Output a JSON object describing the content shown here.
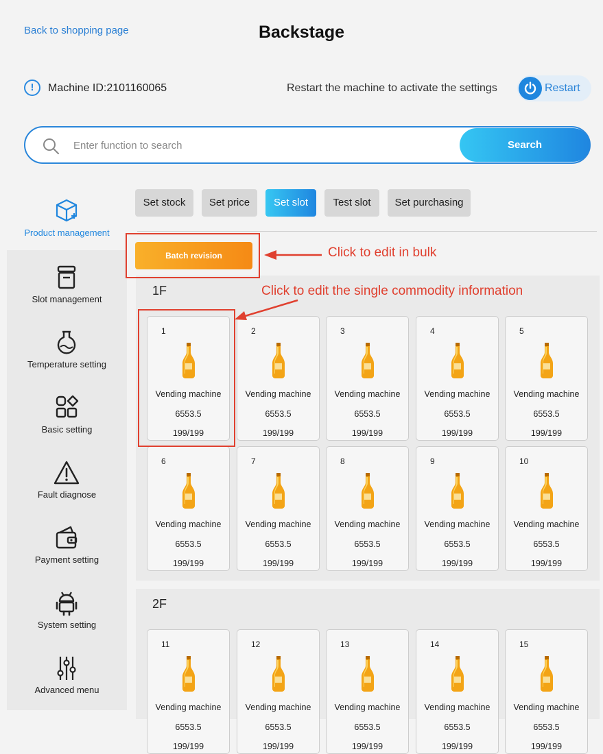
{
  "header": {
    "back_link": "Back to shopping page",
    "title": "Backstage",
    "machine_id": "Machine ID:2101160065",
    "restart_hint": "Restart the machine to activate the settings",
    "restart_label": "Restart",
    "info_glyph": "!"
  },
  "search": {
    "placeholder": "Enter function to search",
    "value": "",
    "button_label": "Search"
  },
  "sidebar": {
    "items": [
      {
        "label": "Product management",
        "icon": "box-icon",
        "active": true
      },
      {
        "label": "Slot management",
        "icon": "archive-icon",
        "active": false
      },
      {
        "label": "Temperature setting",
        "icon": "flask-icon",
        "active": false
      },
      {
        "label": "Basic setting",
        "icon": "grid-icon",
        "active": false
      },
      {
        "label": "Fault diagnose",
        "icon": "warning-icon",
        "active": false
      },
      {
        "label": "Payment setting",
        "icon": "wallet-icon",
        "active": false
      },
      {
        "label": "System setting",
        "icon": "android-icon",
        "active": false
      },
      {
        "label": "Advanced menu",
        "icon": "sliders-icon",
        "active": false
      }
    ]
  },
  "tabs": [
    {
      "label": "Set stock",
      "active": false
    },
    {
      "label": "Set price",
      "active": false
    },
    {
      "label": "Set slot",
      "active": true
    },
    {
      "label": "Test slot",
      "active": false
    },
    {
      "label": "Set purchasing",
      "active": false
    }
  ],
  "batch_button": "Batch revision",
  "annotations": {
    "bulk": "Click to edit in bulk",
    "single": "Click to edit the single commodity information"
  },
  "floors": [
    {
      "title": "1F",
      "slots": [
        {
          "num": "1",
          "name": "Vending machine",
          "price": "6553.5",
          "stock": "199/199"
        },
        {
          "num": "2",
          "name": "Vending machine",
          "price": "6553.5",
          "stock": "199/199"
        },
        {
          "num": "3",
          "name": "Vending machine",
          "price": "6553.5",
          "stock": "199/199"
        },
        {
          "num": "4",
          "name": "Vending machine",
          "price": "6553.5",
          "stock": "199/199"
        },
        {
          "num": "5",
          "name": "Vending machine",
          "price": "6553.5",
          "stock": "199/199"
        },
        {
          "num": "6",
          "name": "Vending machine",
          "price": "6553.5",
          "stock": "199/199"
        },
        {
          "num": "7",
          "name": "Vending machine",
          "price": "6553.5",
          "stock": "199/199"
        },
        {
          "num": "8",
          "name": "Vending machine",
          "price": "6553.5",
          "stock": "199/199"
        },
        {
          "num": "9",
          "name": "Vending machine",
          "price": "6553.5",
          "stock": "199/199"
        },
        {
          "num": "10",
          "name": "Vending machine",
          "price": "6553.5",
          "stock": "199/199"
        }
      ]
    },
    {
      "title": "2F",
      "slots": [
        {
          "num": "11",
          "name": "Vending machine",
          "price": "6553.5",
          "stock": "199/199"
        },
        {
          "num": "12",
          "name": "Vending machine",
          "price": "6553.5",
          "stock": "199/199"
        },
        {
          "num": "13",
          "name": "Vending machine",
          "price": "6553.5",
          "stock": "199/199"
        },
        {
          "num": "14",
          "name": "Vending machine",
          "price": "6553.5",
          "stock": "199/199"
        },
        {
          "num": "15",
          "name": "Vending machine",
          "price": "6553.5",
          "stock": "199/199"
        }
      ]
    }
  ],
  "colors": {
    "accent": "#1f86de",
    "orange": "#f59a1f",
    "annotation": "#e0402f"
  }
}
